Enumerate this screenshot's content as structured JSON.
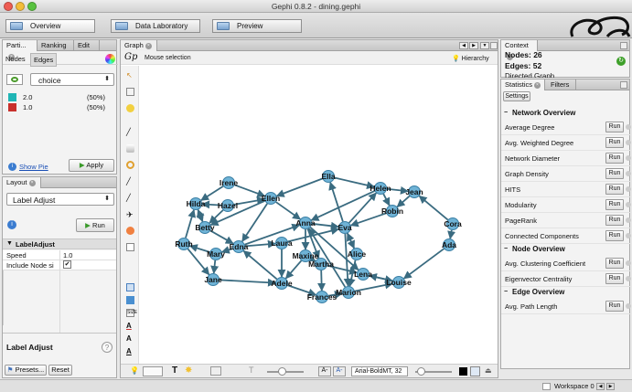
{
  "window": {
    "title": "Gephi 0.8.2 - dining.gephi"
  },
  "toolbar": {
    "overview": "Overview",
    "data_lab": "Data Laboratory",
    "preview": "Preview"
  },
  "partition": {
    "tabs": [
      "Parti...",
      "Ranking",
      "Edit"
    ],
    "subtabs": [
      "Nodes",
      "Edges"
    ],
    "selected_attribute": "choice",
    "items": [
      {
        "label": "2.0",
        "pct": "(50%)",
        "color": "#1fb5b5"
      },
      {
        "label": "1.0",
        "pct": "(50%)",
        "color": "#c8302c"
      }
    ],
    "show_pie": "Show Pie",
    "apply": "Apply"
  },
  "layout": {
    "tab": "Layout",
    "algorithm": "Label Adjust",
    "run": "Run",
    "group": "LabelAdjust",
    "props": [
      {
        "name": "Speed",
        "value": "1.0"
      },
      {
        "name": "Include Node si",
        "value": "✔"
      }
    ],
    "desc_title": "Label Adjust",
    "presets": "Presets...",
    "reset": "Reset"
  },
  "graph": {
    "tab": "Graph",
    "mouse_mode": "Mouse selection",
    "hierarchy": "Hierarchy",
    "font_label": "Arial-BoldMT, 32",
    "nodes": [
      "Irene",
      "Ella",
      "Helen",
      "Jean",
      "Hilda",
      "Hazel",
      "Ellen",
      "Robin",
      "Betty",
      "Anna",
      "Eva",
      "Cora",
      "Ruth",
      "Mary",
      "Edna",
      "Laura",
      "Alice",
      "Ada",
      "Maxine",
      "Martha",
      "Jane",
      "Adele",
      "Lena",
      "Louise",
      "Frances",
      "Marion"
    ]
  },
  "context": {
    "tab": "Context",
    "nodes_label": "Nodes:",
    "nodes_value": "26",
    "edges_label": "Edges:",
    "edges_value": "52",
    "graph_type": "Directed Graph"
  },
  "statistics": {
    "tabs": [
      "Statistics",
      "Filters"
    ],
    "settings": "Settings",
    "run": "Run",
    "sections": [
      {
        "title": "Network Overview",
        "items": [
          "Average Degree",
          "Avg. Weighted Degree",
          "Network Diameter",
          "Graph Density",
          "HITS",
          "Modularity",
          "PageRank",
          "Connected Components"
        ]
      },
      {
        "title": "Node Overview",
        "items": [
          "Avg. Clustering Coefficient",
          "Eigenvector Centrality"
        ]
      },
      {
        "title": "Edge Overview",
        "items": [
          "Avg. Path Length"
        ]
      }
    ]
  },
  "statusbar": {
    "workspace": "Workspace 0"
  }
}
